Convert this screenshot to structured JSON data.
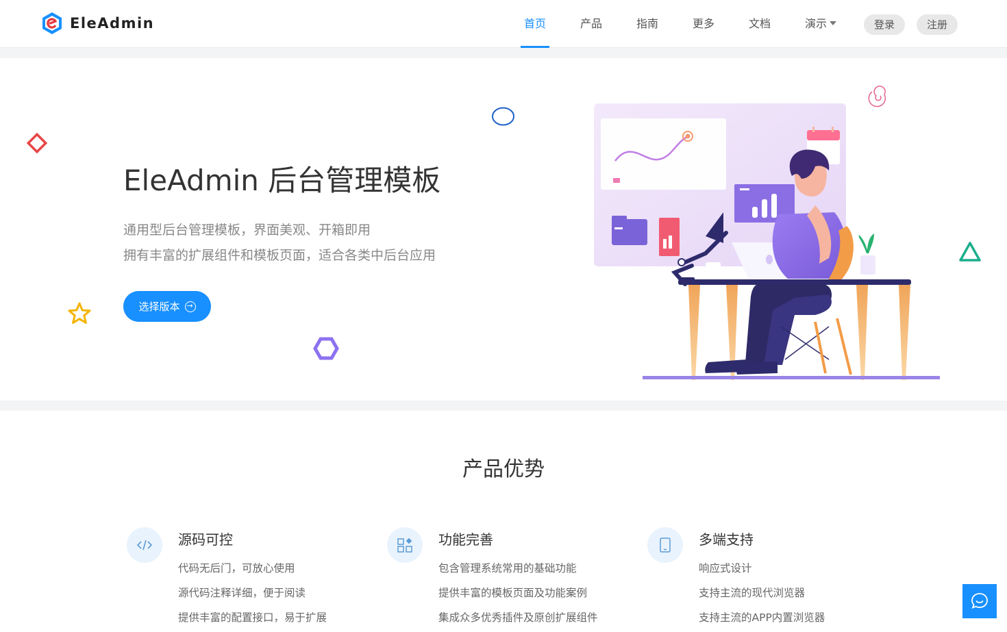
{
  "header": {
    "brand": "EleAdmin",
    "nav": [
      {
        "label": "首页",
        "active": true
      },
      {
        "label": "产品",
        "active": false
      },
      {
        "label": "指南",
        "active": false
      },
      {
        "label": "更多",
        "active": false
      },
      {
        "label": "文档",
        "active": false
      },
      {
        "label": "演示",
        "active": false,
        "dropdown": true
      }
    ],
    "login_label": "登录",
    "register_label": "注册"
  },
  "hero": {
    "title": "EleAdmin 后台管理模板",
    "subtitle_line1": "通用型后台管理模板，界面美观、开箱即用",
    "subtitle_line2": "拥有丰富的扩展组件和模板页面，适合各类中后台应用",
    "cta_label": "选择版本"
  },
  "features": {
    "title": "产品优势",
    "items": [
      {
        "icon": "code-icon",
        "title": "源码可控",
        "lines": [
          "代码无后门，可放心使用",
          "源代码注释详细，便于阅读",
          "提供丰富的配置接口，易于扩展"
        ]
      },
      {
        "icon": "apps-icon",
        "title": "功能完善",
        "lines": [
          "包含管理系统常用的基础功能",
          "提供丰富的模板页面及功能案例",
          "集成众多优秀插件及原创扩展组件"
        ]
      },
      {
        "icon": "tablet-icon",
        "title": "多端支持",
        "lines": [
          "响应式设计",
          "支持主流的现代浏览器",
          "支持主流的APP内置浏览器"
        ]
      }
    ]
  },
  "colors": {
    "accent": "#1890ff",
    "decoration_red": "#e84545",
    "decoration_yellow": "#f5b400",
    "decoration_purple": "#8c72f0",
    "decoration_green": "#1aae8b"
  }
}
